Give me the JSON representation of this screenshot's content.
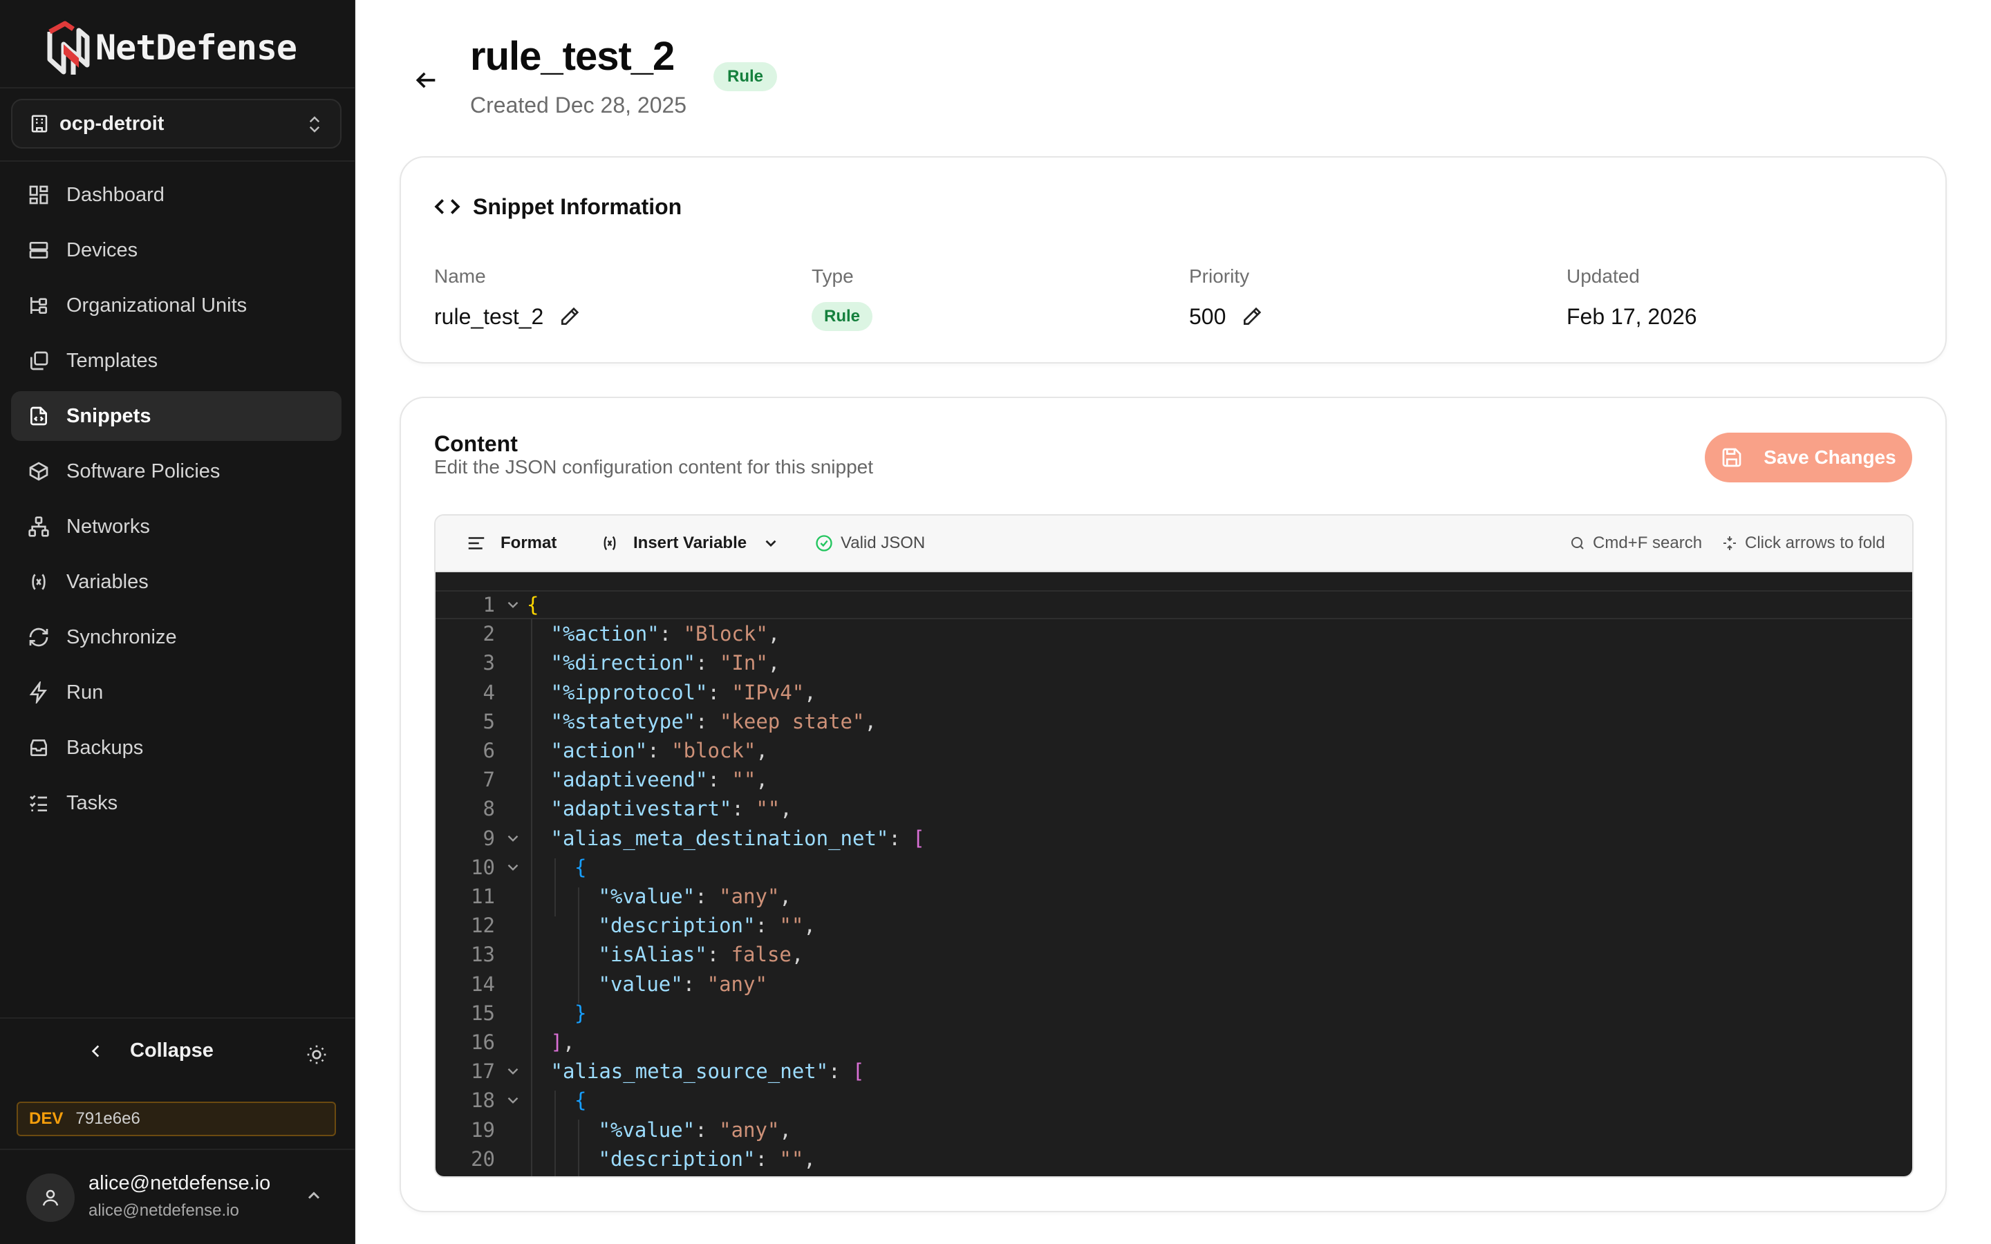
{
  "app": {
    "brand": "NetDefense",
    "org": "ocp-detroit"
  },
  "sidebar": {
    "items": [
      {
        "label": "Dashboard",
        "icon": "dashboard-icon"
      },
      {
        "label": "Devices",
        "icon": "server-icon"
      },
      {
        "label": "Organizational Units",
        "icon": "org-tree-icon"
      },
      {
        "label": "Templates",
        "icon": "templates-icon"
      },
      {
        "label": "Snippets",
        "icon": "snippet-file-icon",
        "active": true
      },
      {
        "label": "Software Policies",
        "icon": "package-icon"
      },
      {
        "label": "Networks",
        "icon": "network-icon"
      },
      {
        "label": "Variables",
        "icon": "variable-icon"
      },
      {
        "label": "Synchronize",
        "icon": "refresh-icon"
      },
      {
        "label": "Run",
        "icon": "bolt-icon"
      },
      {
        "label": "Backups",
        "icon": "archive-icon"
      },
      {
        "label": "Tasks",
        "icon": "list-checks-icon"
      }
    ],
    "collapse_label": "Collapse",
    "env_badge": "DEV",
    "build_hash": "791e6e6",
    "user_name": "alice@netdefense.io",
    "user_email": "alice@netdefense.io"
  },
  "header": {
    "title": "rule_test_2",
    "badge": "Rule",
    "created": "Created Dec 28, 2025"
  },
  "info": {
    "heading": "Snippet Information",
    "fields": {
      "name": {
        "label": "Name",
        "value": "rule_test_2"
      },
      "type": {
        "label": "Type",
        "value": "Rule"
      },
      "priority": {
        "label": "Priority",
        "value": "500"
      },
      "updated": {
        "label": "Updated",
        "value": "Feb 17, 2026"
      }
    }
  },
  "content": {
    "title": "Content",
    "subtitle": "Edit the JSON configuration content for this snippet",
    "save_label": "Save Changes",
    "toolbar": {
      "format": "Format",
      "insert_variable": "Insert Variable",
      "valid": "Valid JSON",
      "search_hint": "Cmd+F search",
      "fold_hint": "Click arrows to fold"
    },
    "lines": [
      {
        "n": "1",
        "indent": 0,
        "fold": true,
        "tokens": [
          [
            "b1",
            "{"
          ]
        ]
      },
      {
        "n": "2",
        "indent": 1,
        "tokens": [
          [
            "k",
            "\"%action\""
          ],
          [
            "p",
            ": "
          ],
          [
            "s",
            "\"Block\""
          ],
          [
            "p",
            ","
          ]
        ]
      },
      {
        "n": "3",
        "indent": 1,
        "tokens": [
          [
            "k",
            "\"%direction\""
          ],
          [
            "p",
            ": "
          ],
          [
            "s",
            "\"In\""
          ],
          [
            "p",
            ","
          ]
        ]
      },
      {
        "n": "4",
        "indent": 1,
        "tokens": [
          [
            "k",
            "\"%ipprotocol\""
          ],
          [
            "p",
            ": "
          ],
          [
            "s",
            "\"IPv4\""
          ],
          [
            "p",
            ","
          ]
        ]
      },
      {
        "n": "5",
        "indent": 1,
        "tokens": [
          [
            "k",
            "\"%statetype\""
          ],
          [
            "p",
            ": "
          ],
          [
            "s",
            "\"keep state\""
          ],
          [
            "p",
            ","
          ]
        ]
      },
      {
        "n": "6",
        "indent": 1,
        "tokens": [
          [
            "k",
            "\"action\""
          ],
          [
            "p",
            ": "
          ],
          [
            "s",
            "\"block\""
          ],
          [
            "p",
            ","
          ]
        ]
      },
      {
        "n": "7",
        "indent": 1,
        "tokens": [
          [
            "k",
            "\"adaptiveend\""
          ],
          [
            "p",
            ": "
          ],
          [
            "s",
            "\"\""
          ],
          [
            "p",
            ","
          ]
        ]
      },
      {
        "n": "8",
        "indent": 1,
        "tokens": [
          [
            "k",
            "\"adaptivestart\""
          ],
          [
            "p",
            ": "
          ],
          [
            "s",
            "\"\""
          ],
          [
            "p",
            ","
          ]
        ]
      },
      {
        "n": "9",
        "indent": 1,
        "fold": true,
        "tokens": [
          [
            "k",
            "\"alias_meta_destination_net\""
          ],
          [
            "p",
            ": "
          ],
          [
            "b2",
            "["
          ]
        ]
      },
      {
        "n": "10",
        "indent": 2,
        "fold": true,
        "tokens": [
          [
            "b3",
            "{"
          ]
        ]
      },
      {
        "n": "11",
        "indent": 3,
        "tokens": [
          [
            "k",
            "\"%value\""
          ],
          [
            "p",
            ": "
          ],
          [
            "s",
            "\"any\""
          ],
          [
            "p",
            ","
          ]
        ]
      },
      {
        "n": "12",
        "indent": 3,
        "tokens": [
          [
            "k",
            "\"description\""
          ],
          [
            "p",
            ": "
          ],
          [
            "s",
            "\"\""
          ],
          [
            "p",
            ","
          ]
        ]
      },
      {
        "n": "13",
        "indent": 3,
        "tokens": [
          [
            "k",
            "\"isAlias\""
          ],
          [
            "p",
            ": "
          ],
          [
            "s",
            "false"
          ],
          [
            "p",
            ","
          ]
        ]
      },
      {
        "n": "14",
        "indent": 3,
        "tokens": [
          [
            "k",
            "\"value\""
          ],
          [
            "p",
            ": "
          ],
          [
            "s",
            "\"any\""
          ]
        ]
      },
      {
        "n": "15",
        "indent": 2,
        "tokens": [
          [
            "b3",
            "}"
          ]
        ]
      },
      {
        "n": "16",
        "indent": 1,
        "tokens": [
          [
            "b2",
            "]"
          ],
          [
            "p",
            ","
          ]
        ]
      },
      {
        "n": "17",
        "indent": 1,
        "fold": true,
        "tokens": [
          [
            "k",
            "\"alias_meta_source_net\""
          ],
          [
            "p",
            ": "
          ],
          [
            "b2",
            "["
          ]
        ]
      },
      {
        "n": "18",
        "indent": 2,
        "fold": true,
        "tokens": [
          [
            "b3",
            "{"
          ]
        ]
      },
      {
        "n": "19",
        "indent": 3,
        "tokens": [
          [
            "k",
            "\"%value\""
          ],
          [
            "p",
            ": "
          ],
          [
            "s",
            "\"any\""
          ],
          [
            "p",
            ","
          ]
        ]
      },
      {
        "n": "20",
        "indent": 3,
        "tokens": [
          [
            "k",
            "\"description\""
          ],
          [
            "p",
            ": "
          ],
          [
            "s",
            "\"\""
          ],
          [
            "p",
            ","
          ]
        ]
      }
    ]
  },
  "colors": {
    "sidebar_bg": "#161616",
    "accent_save": "#f9a188",
    "badge_green_bg": "#dcf5e3",
    "badge_green_text": "#15803d",
    "editor_bg": "#1e1e1e",
    "dev_amber": "#f59e0b"
  }
}
